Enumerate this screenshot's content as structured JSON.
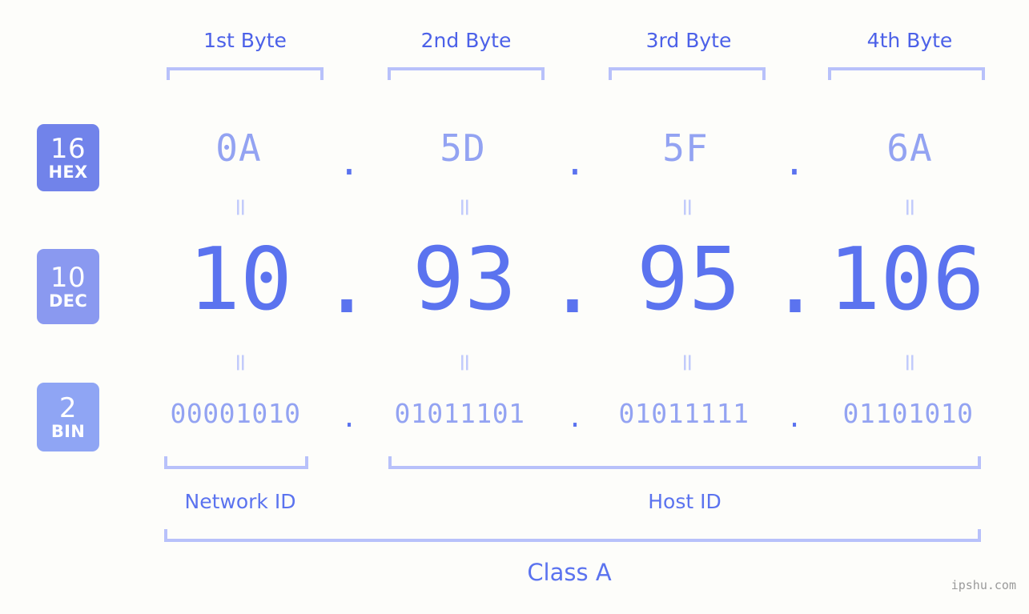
{
  "page": {
    "watermark": "ipshu.com",
    "accent_strong": "#5b73ef",
    "accent_light": "#93a3f2",
    "bracket_color": "#b8c1fa",
    "background": "#fdfdfa"
  },
  "byte_headers": [
    {
      "label": "1st Byte"
    },
    {
      "label": "2nd Byte"
    },
    {
      "label": "3rd Byte"
    },
    {
      "label": "4th Byte"
    }
  ],
  "radix_badges": [
    {
      "number": "16",
      "name": "HEX",
      "color": "#7183ea"
    },
    {
      "number": "10",
      "name": "DEC",
      "color": "#8a99f0"
    },
    {
      "number": "2",
      "name": "BIN",
      "color": "#8fa5f4"
    }
  ],
  "rows": {
    "hex": {
      "values": [
        "0A",
        "5D",
        "5F",
        "6A"
      ],
      "separator": "."
    },
    "dec": {
      "values": [
        "10",
        "93",
        "95",
        "106"
      ],
      "separator": "."
    },
    "bin": {
      "values": [
        "00001010",
        "01011101",
        "01011111",
        "01101010"
      ],
      "separator": "."
    }
  },
  "equality_marks": {
    "symbol": "=",
    "count_per_row": 4
  },
  "id_sections": [
    {
      "label": "Network ID"
    },
    {
      "label": "Host ID"
    }
  ],
  "class_section": {
    "label": "Class A"
  },
  "ip_address": {
    "dec": "10.93.95.106",
    "hex": "0A.5D.5F.6A",
    "bin": "00001010.01011101.01011111.01101010",
    "class": "Class A"
  }
}
